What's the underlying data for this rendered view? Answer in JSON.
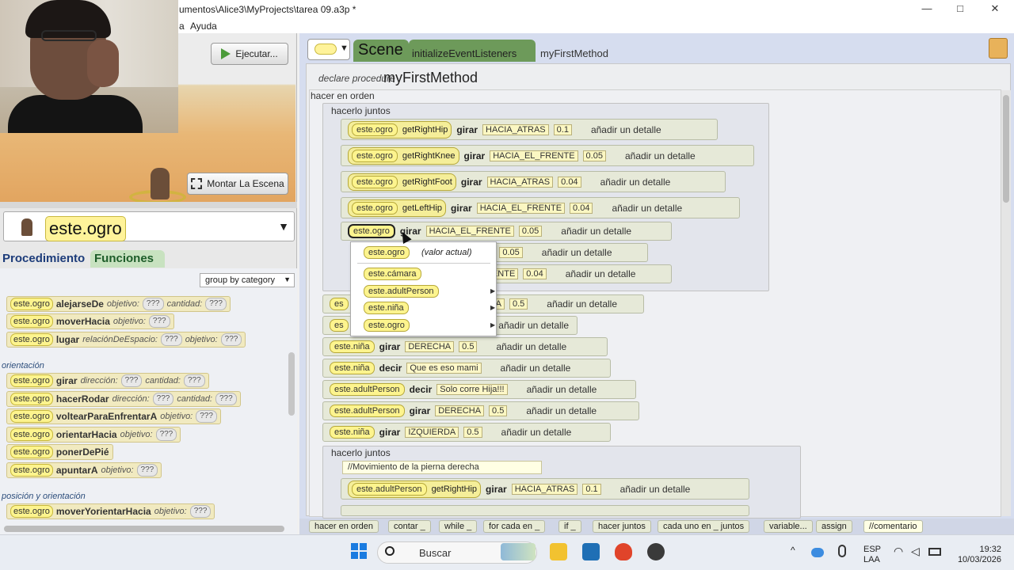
{
  "window": {
    "title": "umentos\\Alice3\\MyProjects\\tarea 09.a3p *",
    "minimize": "—",
    "maximize": "□",
    "close": "✕"
  },
  "menubar": {
    "items": [
      "a",
      "Ayuda"
    ]
  },
  "scene_controls": {
    "run_label": "Ejecutar...",
    "setup_label": "Montar La Escena"
  },
  "object_selector": {
    "value": "este.ogro"
  },
  "left_tabs": {
    "procedures": "Procedimiento",
    "functions": "Funciones"
  },
  "group_by": "group by category",
  "left_tiles": [
    {
      "obj": "este.ogro",
      "method": "alejarseDe",
      "args": [
        [
          "objetivo:",
          "???"
        ],
        [
          "cantidad:",
          "???"
        ]
      ]
    },
    {
      "obj": "este.ogro",
      "method": "moverHacia",
      "args": [
        [
          "objetivo:",
          "???"
        ]
      ]
    },
    {
      "obj": "este.ogro",
      "method": "lugar",
      "args": [
        [
          "relaciónDeEspacio:",
          "???"
        ],
        [
          "objetivo:",
          "???"
        ]
      ]
    },
    {
      "obj": "este.ogro",
      "method": "girar",
      "args": [
        [
          "dirección:",
          "???"
        ],
        [
          "cantidad:",
          "???"
        ]
      ]
    },
    {
      "obj": "este.ogro",
      "method": "hacerRodar",
      "args": [
        [
          "dirección:",
          "???"
        ],
        [
          "cantidad:",
          "???"
        ]
      ]
    },
    {
      "obj": "este.ogro",
      "method": "voltearParaEnfrentarA",
      "args": [
        [
          "objetivo:",
          "???"
        ]
      ]
    },
    {
      "obj": "este.ogro",
      "method": "orientarHacia",
      "args": [
        [
          "objetivo:",
          "???"
        ]
      ]
    },
    {
      "obj": "este.ogro",
      "method": "ponerDePié",
      "args": []
    },
    {
      "obj": "este.ogro",
      "method": "apuntarA",
      "args": [
        [
          "objetivo:",
          "???"
        ]
      ]
    },
    {
      "obj": "este.ogro",
      "method": "moverYorientarHacia",
      "args": [
        [
          "objetivo:",
          "???"
        ]
      ]
    }
  ],
  "left_sections": {
    "orientation": "orientación",
    "position_orientation": "posición y orientación"
  },
  "code_tabs": {
    "scene": "Scene",
    "init": "initializeEventListeners",
    "method": "myFirstMethod"
  },
  "procedure": {
    "declare": "declare procedure",
    "name": "myFirstMethod",
    "do_in_order": "hacer en orden",
    "do_together": "hacerlo juntos"
  },
  "statements": {
    "s1": {
      "obj": "este.ogro",
      "getter": "getRightHip",
      "verb": "girar",
      "dir": "HACIA_ATRAS",
      "amount": "0.1",
      "detail": "añadir un detalle"
    },
    "s2": {
      "obj": "este.ogro",
      "getter": "getRightKnee",
      "verb": "girar",
      "dir": "HACIA_EL_FRENTE",
      "amount": "0.05",
      "detail": "añadir un detalle"
    },
    "s3": {
      "obj": "este.ogro",
      "getter": "getRightFoot",
      "verb": "girar",
      "dir": "HACIA_ATRAS",
      "amount": "0.04",
      "detail": "añadir un detalle"
    },
    "s4": {
      "obj": "este.ogro",
      "getter": "getLeftHip",
      "verb": "girar",
      "dir": "HACIA_EL_FRENTE",
      "amount": "0.04",
      "detail": "añadir un detalle"
    },
    "s5": {
      "obj": "este.ogro",
      "verb": "girar",
      "dir": "HACIA_EL_FRENTE",
      "amount": "0.05",
      "detail": "añadir un detalle"
    },
    "s6": {
      "dir": "S",
      "amount": "0.05",
      "detail": "añadir un detalle"
    },
    "s7": {
      "dir": "RENTE",
      "amount": "0.04",
      "detail": "añadir un detalle"
    },
    "s8": {
      "obj": "es",
      "dir": "A",
      "amount": "0.5",
      "detail": "añadir un detalle"
    },
    "s9": {
      "obj": "es",
      "detail": "añadir un detalle"
    },
    "s10": {
      "obj": "este.niña",
      "verb": "girar",
      "dir": "DERECHA",
      "amount": "0.5",
      "detail": "añadir un detalle"
    },
    "s11": {
      "obj": "este.niña",
      "verb": "decir",
      "text": "Que es eso mami",
      "detail": "añadir un detalle"
    },
    "s12": {
      "obj": "este.adultPerson",
      "verb": "decir",
      "text": "Solo corre Hija!!!",
      "detail": "añadir un detalle"
    },
    "s13": {
      "obj": "este.adultPerson",
      "verb": "girar",
      "dir": "DERECHA",
      "amount": "0.5",
      "detail": "añadir un detalle"
    },
    "s14": {
      "obj": "este.niña",
      "verb": "girar",
      "dir": "IZQUIERDA",
      "amount": "0.5",
      "detail": "añadir un detalle"
    },
    "comment": "//Movimiento de la pierna derecha",
    "s15": {
      "obj": "este.adultPerson",
      "getter": "getRightHip",
      "verb": "girar",
      "dir": "HACIA_ATRAS",
      "amount": "0.1",
      "detail": "añadir un detalle"
    }
  },
  "context_menu": {
    "current": {
      "obj": "este.ogro",
      "label": "(valor actual)"
    },
    "items": [
      "este.cámara",
      "este.adultPerson",
      "este.niña",
      "este.ogro"
    ]
  },
  "palette": [
    "hacer en orden",
    "contar _",
    "while _",
    "for cada en _",
    "if _",
    "hacer juntos",
    "cada uno en _ juntos",
    "variable...",
    "assign",
    "//comentario"
  ],
  "taskbar": {
    "search": "Buscar",
    "lang1": "ESP",
    "lang2": "LAA",
    "time": "19:32",
    "date": "10/03/2026"
  },
  "colors": {
    "object_chip": "#fdf48e",
    "statement": "#e6e9d8",
    "code_bg": "#edeef0",
    "tab_green": "#6d9a5a"
  }
}
